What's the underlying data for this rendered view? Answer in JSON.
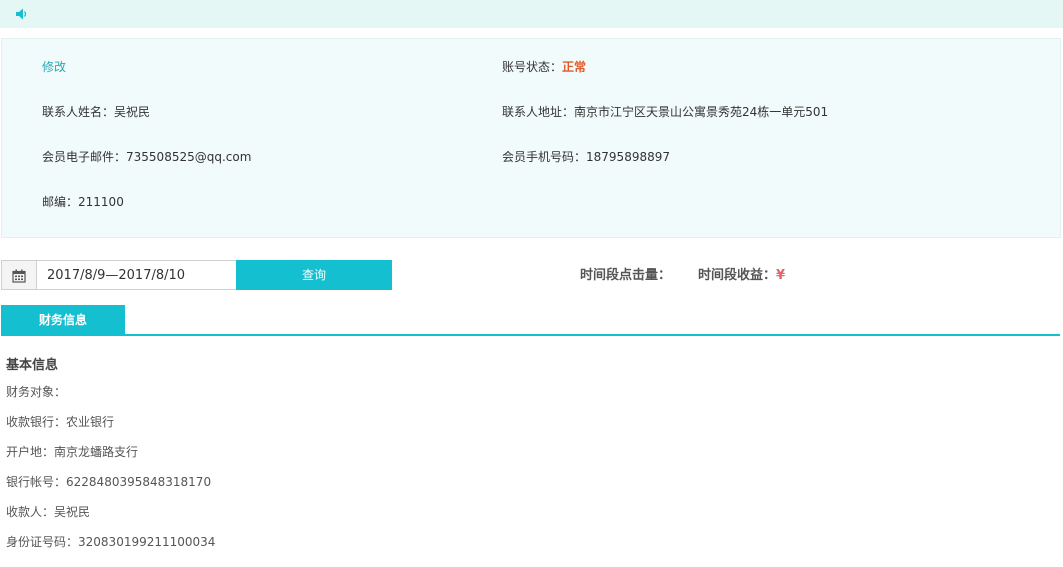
{
  "topbar": {
    "icon": "speaker-icon"
  },
  "profile": {
    "edit_label": "修改",
    "status_label": "账号状态：",
    "status_value": "正常",
    "contact_name_label": "联系人姓名：",
    "contact_name_value": "吴祝民",
    "contact_address_label": "联系人地址：",
    "contact_address_value": "南京市江宁区天景山公寓景秀苑24栋一单元501",
    "email_label": "会员电子邮件：",
    "email_value": "735508525@qq.com",
    "phone_label": "会员手机号码：",
    "phone_value": "18795898897",
    "postcode_label": "邮编：",
    "postcode_value": "211100"
  },
  "query": {
    "calendar_icon": "calendar-icon",
    "date_range": "2017/8/9—2017/8/10",
    "button_label": "查询",
    "clicks_label": "时间段点击量：",
    "earnings_label": "时间段收益：",
    "currency_symbol": "¥"
  },
  "tabs": [
    {
      "label": "财务信息",
      "active": true
    }
  ],
  "finance": {
    "section_title": "基本信息",
    "object_label": "财务对象：",
    "object_value": "",
    "bank_label": "收款银行：",
    "bank_value": "农业银行",
    "branch_label": "开户地：",
    "branch_value": "南京龙蟠路支行",
    "account_label": "银行帐号：",
    "account_value": "6228480395848318170",
    "payee_label": "收款人：",
    "payee_value": "吴祝民",
    "id_label": "身份证号码：",
    "id_value": "320830199211100034"
  },
  "colors": {
    "accent": "#14bfcf",
    "status": "#e35b2b",
    "currency": "#e3626e",
    "topbar_bg": "#e4f7f4",
    "profile_bg": "#f2fbfb"
  }
}
